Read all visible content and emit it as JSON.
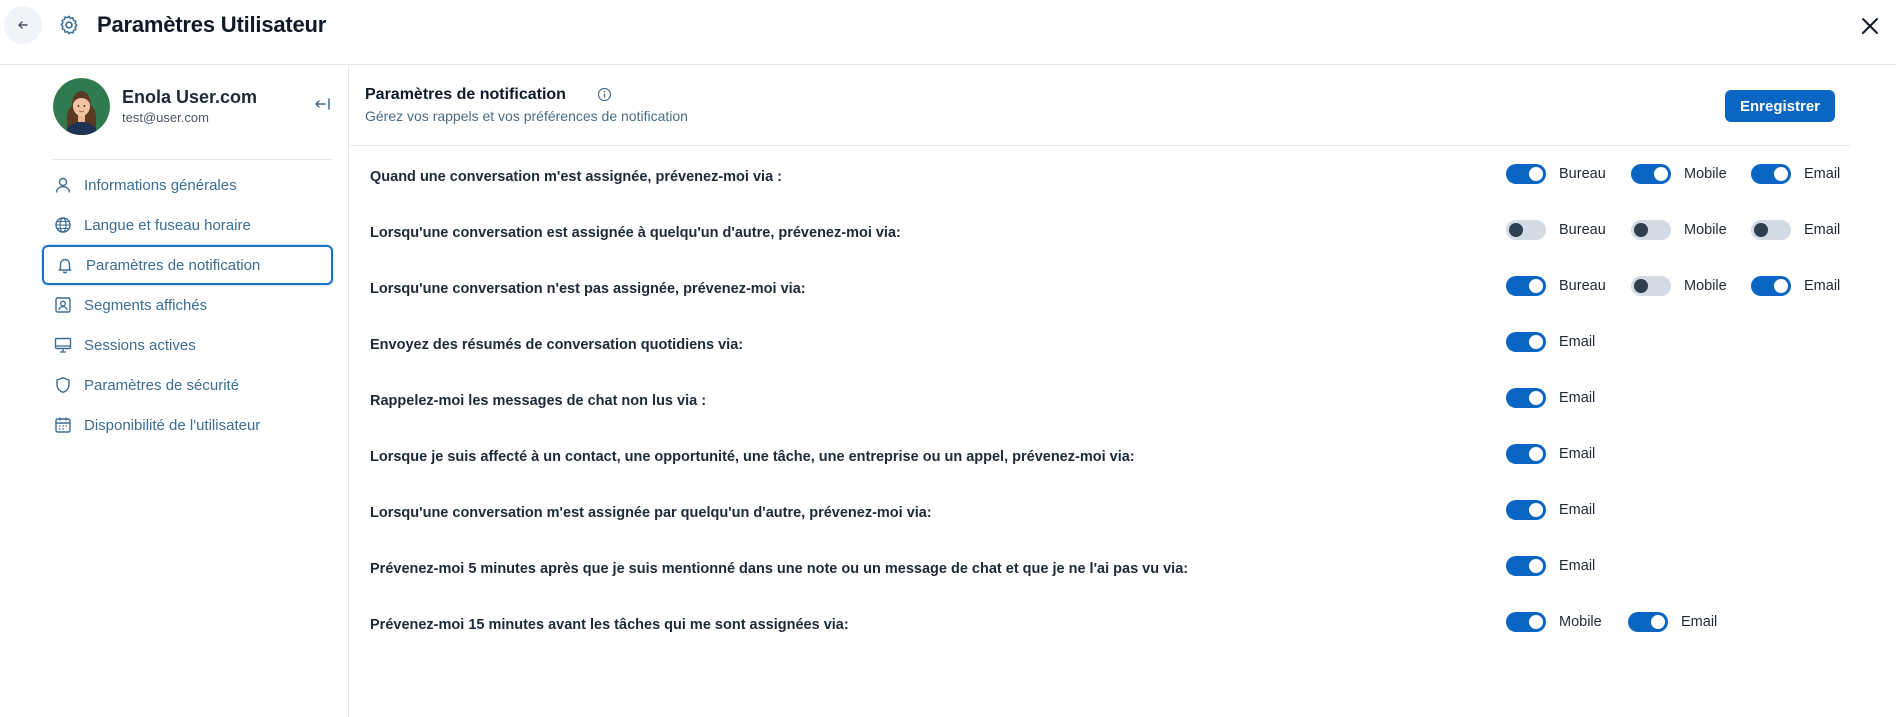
{
  "header": {
    "title": "Paramètres Utilisateur",
    "back_icon": "arrow-left-icon",
    "settings_icon": "gear-icon",
    "close_icon": "close-icon"
  },
  "profile": {
    "name": "Enola User.com",
    "email": "test@user.com"
  },
  "sidebar": {
    "items": [
      {
        "label": "Informations générales",
        "icon": "user-icon",
        "active": false
      },
      {
        "label": "Langue et fuseau horaire",
        "icon": "globe-icon",
        "active": false
      },
      {
        "label": "Paramètres de notification",
        "icon": "bell-icon",
        "active": true
      },
      {
        "label": "Segments affichés",
        "icon": "contact-card-icon",
        "active": false
      },
      {
        "label": "Sessions actives",
        "icon": "monitor-icon",
        "active": false
      },
      {
        "label": "Paramètres de sécurité",
        "icon": "shield-icon",
        "active": false
      },
      {
        "label": "Disponibilité de l'utilisateur",
        "icon": "calendar-icon",
        "active": false
      }
    ]
  },
  "main": {
    "title": "Paramètres de notification",
    "subtitle": "Gérez vos rappels et vos préférences de notification",
    "save_label": "Enregistrer",
    "rows": [
      {
        "label": "Quand une conversation m'est assignée, prévenez-moi via :",
        "options": [
          {
            "label": "Bureau",
            "on": true
          },
          {
            "label": "Mobile",
            "on": true
          },
          {
            "label": "Email",
            "on": true
          }
        ]
      },
      {
        "label": "Lorsqu'une conversation est assignée à quelqu'un d'autre, prévenez-moi via:",
        "options": [
          {
            "label": "Bureau",
            "on": false
          },
          {
            "label": "Mobile",
            "on": false
          },
          {
            "label": "Email",
            "on": false
          }
        ]
      },
      {
        "label": "Lorsqu'une conversation n'est pas assignée, prévenez-moi via:",
        "options": [
          {
            "label": "Bureau",
            "on": true
          },
          {
            "label": "Mobile",
            "on": false
          },
          {
            "label": "Email",
            "on": true
          }
        ]
      },
      {
        "label": "Envoyez des résumés de conversation quotidiens via:",
        "options": [
          {
            "label": "Email",
            "on": true
          }
        ]
      },
      {
        "label": "Rappelez-moi les messages de chat non lus via :",
        "options": [
          {
            "label": "Email",
            "on": true
          }
        ]
      },
      {
        "label": "Lorsque je suis affecté à un contact, une opportunité, une tâche, une entreprise ou un appel, prévenez-moi via:",
        "options": [
          {
            "label": "Email",
            "on": true
          }
        ]
      },
      {
        "label": "Lorsqu'une conversation m'est assignée par quelqu'un d'autre, prévenez-moi via:",
        "options": [
          {
            "label": "Email",
            "on": true
          }
        ]
      },
      {
        "label": "Prévenez-moi 5 minutes après que je suis mentionné dans une note ou un message de chat et que je ne l'ai pas vu via:",
        "options": [
          {
            "label": "Email",
            "on": true
          }
        ]
      },
      {
        "label": "Prévenez-moi 15 minutes avant les tâches qui me sont assignées via:",
        "options": [
          {
            "label": "Mobile",
            "on": true
          },
          {
            "label": "Email",
            "on": true
          }
        ]
      }
    ]
  },
  "colors": {
    "accent": "#0b66c3",
    "nav_text": "#3b6c92",
    "toggle_off": "#d3dbe5"
  }
}
